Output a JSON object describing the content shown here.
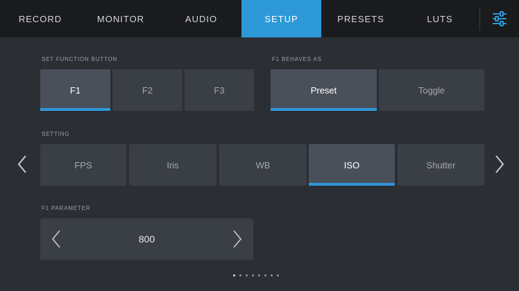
{
  "tabs": [
    "RECORD",
    "MONITOR",
    "AUDIO",
    "SETUP",
    "PRESETS",
    "LUTS"
  ],
  "active_tab": "SETUP",
  "section_labels": {
    "set_function_button": "SET FUNCTION BUTTON",
    "f1_behaves_as": "F1 BEHAVES AS",
    "setting": "SETTING",
    "f1_parameter": "F1 PARAMETER"
  },
  "function_buttons": [
    {
      "label": "F1",
      "selected": true
    },
    {
      "label": "F2",
      "selected": false
    },
    {
      "label": "F3",
      "selected": false
    }
  ],
  "behaves_as": [
    {
      "label": "Preset",
      "selected": true
    },
    {
      "label": "Toggle",
      "selected": false
    }
  ],
  "settings": [
    {
      "label": "FPS",
      "selected": false
    },
    {
      "label": "Iris",
      "selected": false
    },
    {
      "label": "WB",
      "selected": false
    },
    {
      "label": "ISO",
      "selected": true
    },
    {
      "label": "Shutter",
      "selected": false
    }
  ],
  "parameter_value": "800",
  "page_indicator": {
    "count": 8,
    "active_index": 0
  },
  "icons": {
    "menu": "settings-sliders-icon",
    "prev": "chevron-left-icon",
    "next": "chevron-right-icon"
  },
  "colors": {
    "accent": "#2d99d9",
    "tab_bar": "#1a1b1d",
    "panel": "#2b2e33",
    "button": "#3a3e45",
    "button_selected": "#4a505a"
  }
}
